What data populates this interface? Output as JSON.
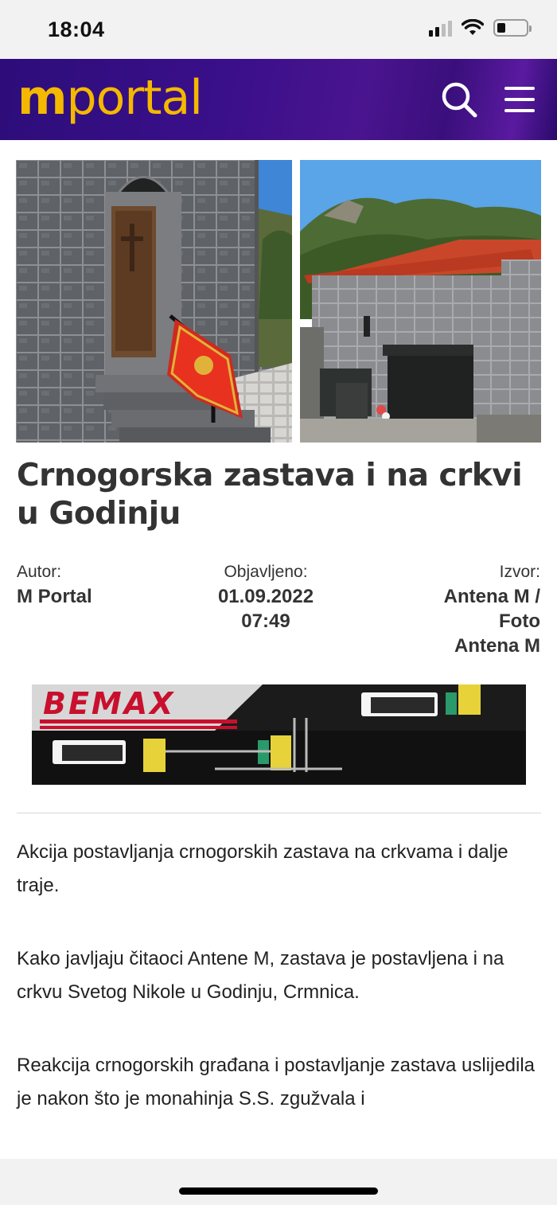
{
  "status_bar": {
    "time": "18:04",
    "icons": [
      "cellular-signal-icon",
      "wifi-icon",
      "battery-icon"
    ],
    "battery_level": 0.3
  },
  "header": {
    "logo_part1": "m",
    "logo_part2": "portal",
    "logo_color": "#f5b800",
    "background_color": "#3a0f8a",
    "search_icon": "search-icon",
    "menu_icon": "hamburger-menu-icon"
  },
  "article": {
    "title": "Crnogorska zastava i na crkvi u Godinju",
    "author_label": "Autor:",
    "author": "M Portal",
    "published_label": "Objavljeno:",
    "published_date": "01.09.2022",
    "published_time": "07:49",
    "source_label": "Izvor:",
    "source_line1": "Antena M /",
    "source_line2": "Foto",
    "source_line3": "Antena M",
    "paragraphs": [
      "Akcija postavljanja crnogorskih zastava na crkvama i dalje traje.",
      "Kako javljaju čitaoci Antene M, zastava je postavljena i na crkvu Svetog Nikole u Godinju, Crmnica.",
      "Reakcija crnogorskih građana i postavljanje zastava uslijedila je nakon što je monahinja S.S. zgužvala i"
    ]
  },
  "ad": {
    "brand": "BEMAX",
    "brand_color": "#c8102e"
  }
}
